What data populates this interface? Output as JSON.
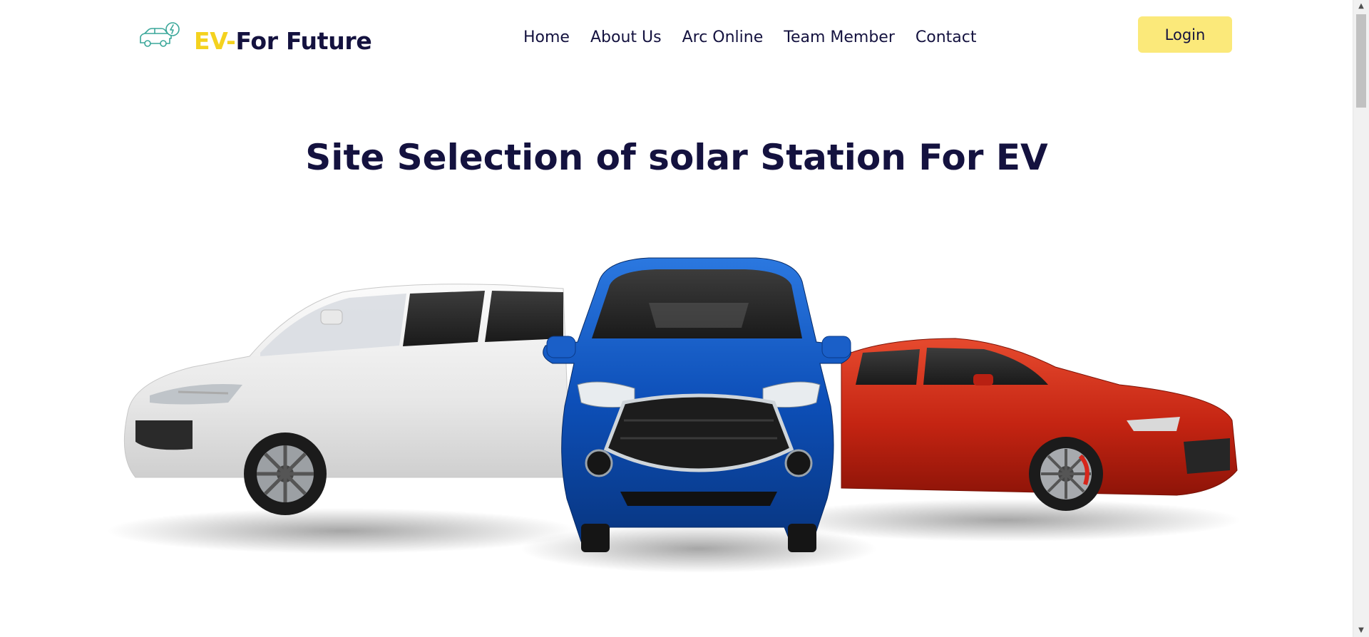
{
  "brand": {
    "ev": "EV",
    "dash": "-",
    "rest": "For Future",
    "logo_icon": "ev-car-charging-icon"
  },
  "nav": {
    "items": [
      {
        "label": "Home"
      },
      {
        "label": "About Us"
      },
      {
        "label": "Arc Online"
      },
      {
        "label": "Team Member"
      },
      {
        "label": "Contact"
      }
    ]
  },
  "header": {
    "login_label": "Login"
  },
  "hero": {
    "title": "Site Selection of solar Station For EV",
    "image_subject": "three cars: white SUV, blue SUV, red sedan"
  },
  "colors": {
    "brand_accent": "#f4d21f",
    "navy_text": "#14123f",
    "login_bg": "#fbe97a",
    "logo_teal": "#3aa79a"
  }
}
